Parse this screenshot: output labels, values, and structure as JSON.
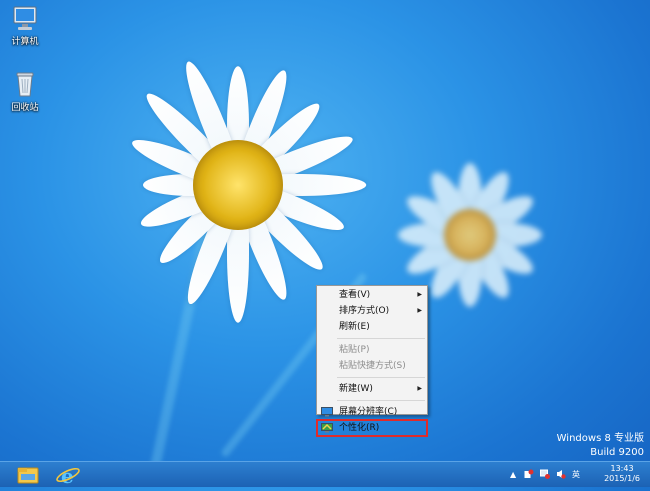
{
  "desktop": {
    "icons": [
      {
        "label": "计算机",
        "icon": "computer-icon"
      },
      {
        "label": "回收站",
        "icon": "recycle-bin-icon"
      }
    ],
    "watermark": {
      "line1": "Windows 8 专业版",
      "line2": "Build 9200"
    }
  },
  "context_menu": {
    "items": {
      "view": "查看(V)",
      "sort": "排序方式(O)",
      "refresh": "刷新(E)",
      "paste": "粘贴(P)",
      "paste_shortcut": "粘贴快捷方式(S)",
      "new": "新建(W)",
      "resolution": "屏幕分辨率(C)",
      "personalize": "个性化(R)"
    },
    "highlight_color": "#e02b2b"
  },
  "taskbar": {
    "pinned": [
      "file-explorer-icon",
      "internet-explorer-icon"
    ],
    "tray": {
      "ime": "英",
      "time": "13:43",
      "date": "2015/1/6"
    }
  }
}
